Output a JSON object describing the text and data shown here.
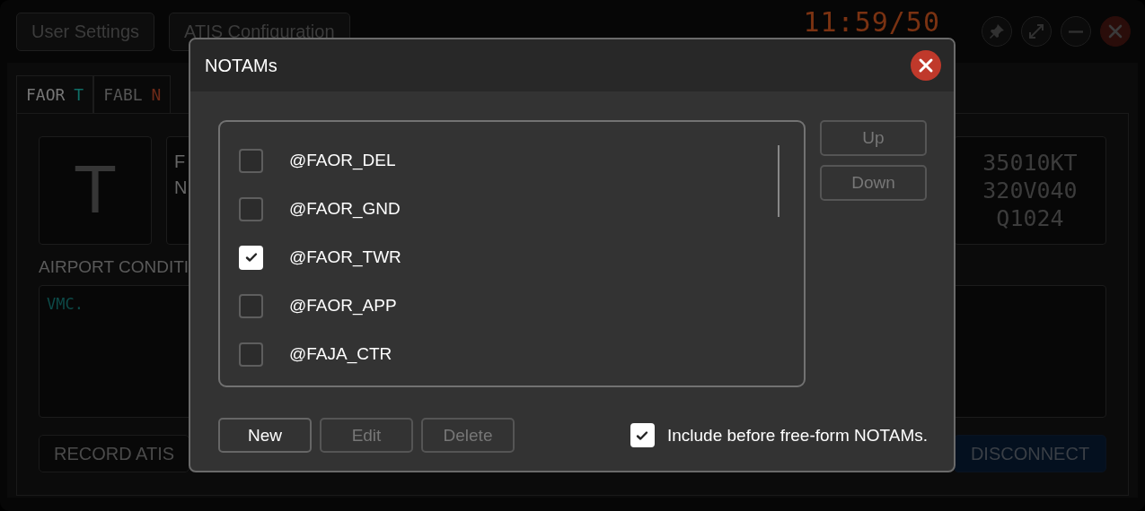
{
  "top_bar": {
    "buttons": [
      "User Settings",
      "ATIS Configuration"
    ],
    "clock": "11:59/50"
  },
  "airport_tabs": [
    {
      "code": "FAOR",
      "letter": "T",
      "color": "#0f6e66",
      "selected": true
    },
    {
      "code": "FABL",
      "letter": "N",
      "color": "#6e2a18",
      "selected": false
    }
  ],
  "atis_letter": "T",
  "info_lines": [
    "F",
    "N"
  ],
  "weather_lines": [
    "35010KT",
    "320V040",
    "Q1024"
  ],
  "conditions_label": "AIRPORT CONDITI",
  "conditions_text": "VMC.",
  "record_button": "RECORD ATIS",
  "disconnect_button": "DISCONNECT",
  "dialog": {
    "title": "NOTAMs",
    "items": [
      {
        "label": "@FAOR_DEL",
        "checked": false
      },
      {
        "label": "@FAOR_GND",
        "checked": false
      },
      {
        "label": "@FAOR_TWR",
        "checked": true
      },
      {
        "label": "@FAOR_APP",
        "checked": false
      },
      {
        "label": "@FAJA_CTR",
        "checked": false
      }
    ],
    "side_buttons": [
      {
        "label": "Up",
        "disabled": true
      },
      {
        "label": "Down",
        "disabled": true
      }
    ],
    "buttons": [
      {
        "label": "New",
        "disabled": false
      },
      {
        "label": "Edit",
        "disabled": true
      },
      {
        "label": "Delete",
        "disabled": true
      }
    ],
    "include_option": {
      "label": "Include before free-form NOTAMs.",
      "checked": true
    }
  }
}
